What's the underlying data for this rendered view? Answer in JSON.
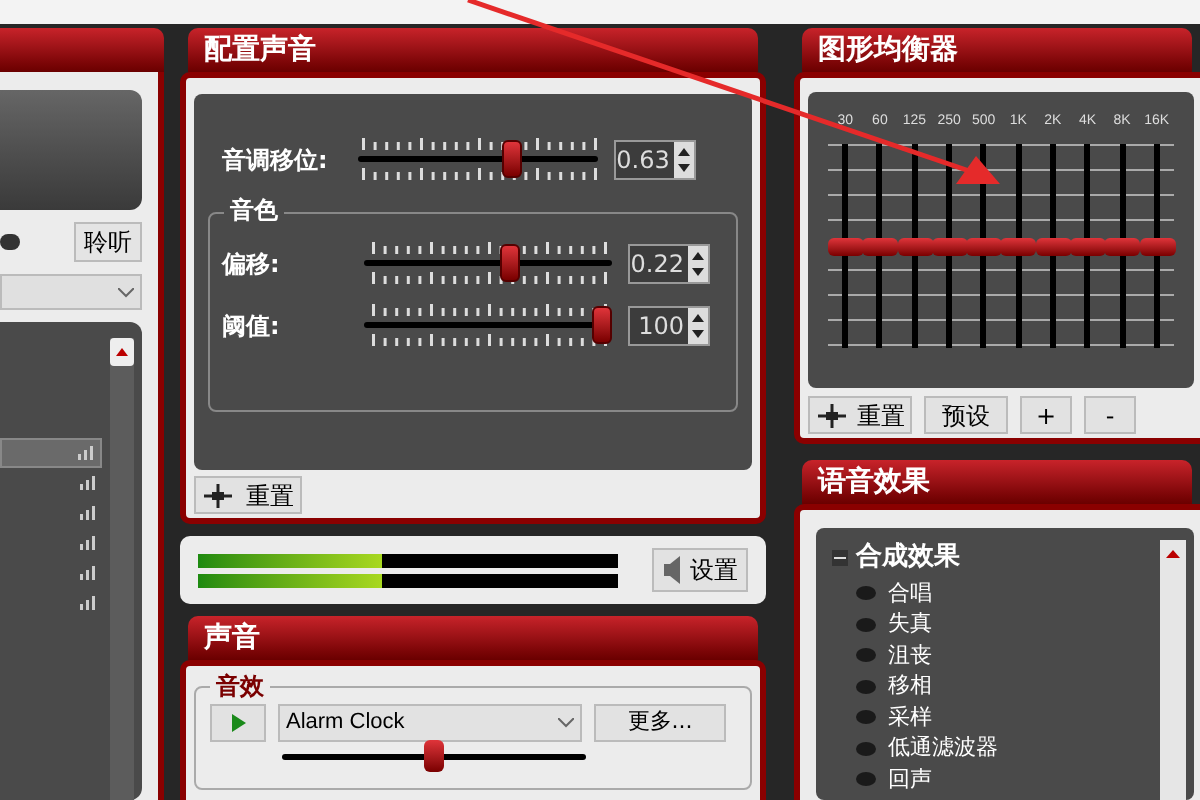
{
  "left_panel": {
    "listen_button": "聆听",
    "rows": [
      {
        "selected": true
      },
      {
        "selected": false
      },
      {
        "selected": false
      },
      {
        "selected": false
      },
      {
        "selected": false
      },
      {
        "selected": false
      }
    ]
  },
  "config_panel": {
    "title": "配置声音",
    "pitch": {
      "label": "音调移位:",
      "level": 0.65,
      "value": "0.63"
    },
    "timbre": {
      "title": "音色",
      "sliders": [
        {
          "label": "偏移:",
          "level": 0.6,
          "value": "0.22"
        },
        {
          "label": "阈值:",
          "level": 1,
          "value": "100"
        }
      ]
    },
    "reset_button": "重置"
  },
  "meter": {
    "level": 0.44,
    "settings_button": "设置"
  },
  "sound_panel": {
    "title": "声音",
    "effects_group": {
      "title": "音效",
      "dropdown": "Alarm Clock",
      "more_button": "更多...",
      "volume": {
        "level": 0.5
      }
    }
  },
  "equalizer": {
    "title": "图形均衡器",
    "bands": [
      {
        "label": "30",
        "level": 0.5
      },
      {
        "label": "60",
        "level": 0.5
      },
      {
        "label": "125",
        "level": 0.5
      },
      {
        "label": "250",
        "level": 0.5
      },
      {
        "label": "500",
        "level": 0.5
      },
      {
        "label": "1K",
        "level": 0.5
      },
      {
        "label": "2K",
        "level": 0.5
      },
      {
        "label": "4K",
        "level": 0.5
      },
      {
        "label": "8K",
        "level": 0.5
      },
      {
        "label": "16K",
        "level": 0.5
      }
    ],
    "buttons": [
      {
        "kind": "reset",
        "label": "重置"
      },
      {
        "kind": "text",
        "label": "预设"
      },
      {
        "kind": "text",
        "label": "+"
      },
      {
        "kind": "text",
        "label": "-"
      }
    ]
  },
  "voice_effects": {
    "title": "语音效果",
    "tree": [
      {
        "label": "合成效果",
        "expanded": true,
        "children": [
          {
            "label": "合唱"
          },
          {
            "label": "失真"
          },
          {
            "label": "沮丧"
          },
          {
            "label": "移相"
          },
          {
            "label": "采样"
          },
          {
            "label": "低通滤波器"
          },
          {
            "label": "回声"
          }
        ]
      }
    ]
  }
}
